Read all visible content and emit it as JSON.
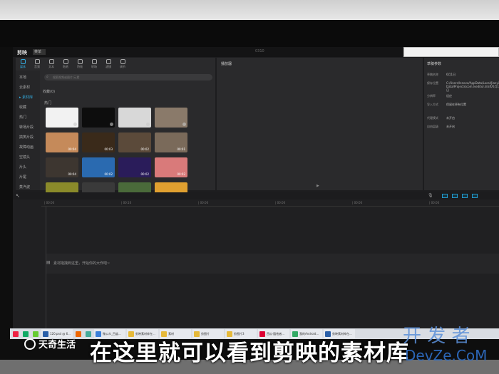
{
  "caption": "在这里就可以看到剪映的素材库",
  "watermark": {
    "logo": "天奇生活",
    "site_cn": "开 发 者",
    "site_en": "DevZe.CoM"
  },
  "app": {
    "name": "剪映",
    "menu": "菜单",
    "window_title": "0310",
    "tool_tabs": [
      {
        "label": "媒体",
        "icon": "media-icon"
      },
      {
        "label": "音频",
        "icon": "audio-icon"
      },
      {
        "label": "文本",
        "icon": "text-icon"
      },
      {
        "label": "贴纸",
        "icon": "sticker-icon"
      },
      {
        "label": "特效",
        "icon": "effect-icon"
      },
      {
        "label": "转场",
        "icon": "transition-icon"
      },
      {
        "label": "滤镜",
        "icon": "filter-icon"
      },
      {
        "label": "调节",
        "icon": "adjust-icon"
      }
    ],
    "side_items": [
      "本地",
      "云素材",
      "▸ 素材库",
      "收藏",
      "热门",
      "转场片段",
      "搞笑片段",
      "故障动画",
      "空镜头",
      "片头",
      "片尾",
      "蒸汽波"
    ],
    "side_active_index": 2,
    "search_placeholder": "搜索视频或图片/元素",
    "lib_subtitle": "收藏(0)",
    "lib_section": "热门",
    "thumbs": [
      {
        "dur": "",
        "color": "#f2f2f2"
      },
      {
        "dur": "",
        "color": "#0d0d0d"
      },
      {
        "dur": "",
        "color": "#d8d8d8"
      },
      {
        "dur": "",
        "color": "#8a7a6a"
      },
      {
        "dur": "00:04",
        "color": "#c58a5a"
      },
      {
        "dur": "00:03",
        "color": "#3a2a1a"
      },
      {
        "dur": "00:02",
        "color": "#5b4a3a"
      },
      {
        "dur": "00:01",
        "color": "#7a6a5a"
      },
      {
        "dur": "00:04",
        "color": "#3d3630"
      },
      {
        "dur": "00:02",
        "color": "#2a6ab0"
      },
      {
        "dur": "00:02",
        "color": "#2a1c5a"
      },
      {
        "dur": "00:02",
        "color": "#d97a7a"
      },
      {
        "dur": "",
        "color": "#8a8a2a"
      },
      {
        "dur": "00:03",
        "color": "#3a3a3a"
      },
      {
        "dur": "00:07",
        "color": "#4a6a3a"
      },
      {
        "dur": "",
        "color": "#e0a030"
      }
    ],
    "player_title": "播放器",
    "props": {
      "title": "草稿参数",
      "rows": [
        {
          "k": "草稿名称",
          "v": "6月1日"
        },
        {
          "k": "保存位置",
          "v": "C:/Users/lenovo/AppData/Local/JianyingPro/User Data/Projects/com.lveditor.draft/6月1日"
        },
        {
          "k": "分辨率",
          "v": "适应"
        },
        {
          "k": "导入方式",
          "v": "保留在原有位置"
        },
        {
          "k": "代理模式",
          "v": "未开启"
        },
        {
          "k": "自由层级",
          "v": "未开启"
        }
      ]
    },
    "timeline": {
      "ticks": [
        "00:00",
        "00:10",
        "00:00",
        "00:00",
        "00:00",
        "00:00",
        "00:00"
      ],
      "hint": "素材拖拽到这里，开始你的大作吧~"
    }
  },
  "taskbar": [
    {
      "label": "",
      "color": "#e24"
    },
    {
      "label": "",
      "color": "#1a6"
    },
    {
      "label": "",
      "color": "#6c3"
    },
    {
      "label": "120.psd @ 6...",
      "color": "#2a5fa8"
    },
    {
      "label": "",
      "color": "#e60"
    },
    {
      "label": "",
      "color": "#4a9"
    },
    {
      "label": "微公众_百度...",
      "color": "#3b7fd9"
    },
    {
      "label": "剪映素材库在...",
      "color": "#e5b93a"
    },
    {
      "label": "素材",
      "color": "#e5b93a"
    },
    {
      "label": "剪图片",
      "color": "#e5b93a"
    },
    {
      "label": "剪图片3",
      "color": "#e5b93a"
    },
    {
      "label": "西瓜·酷他者...",
      "color": "#d03"
    },
    {
      "label": "我的Android...",
      "color": "#3a6"
    },
    {
      "label": "剪映素材库在...",
      "color": "#2a5fa8"
    }
  ]
}
